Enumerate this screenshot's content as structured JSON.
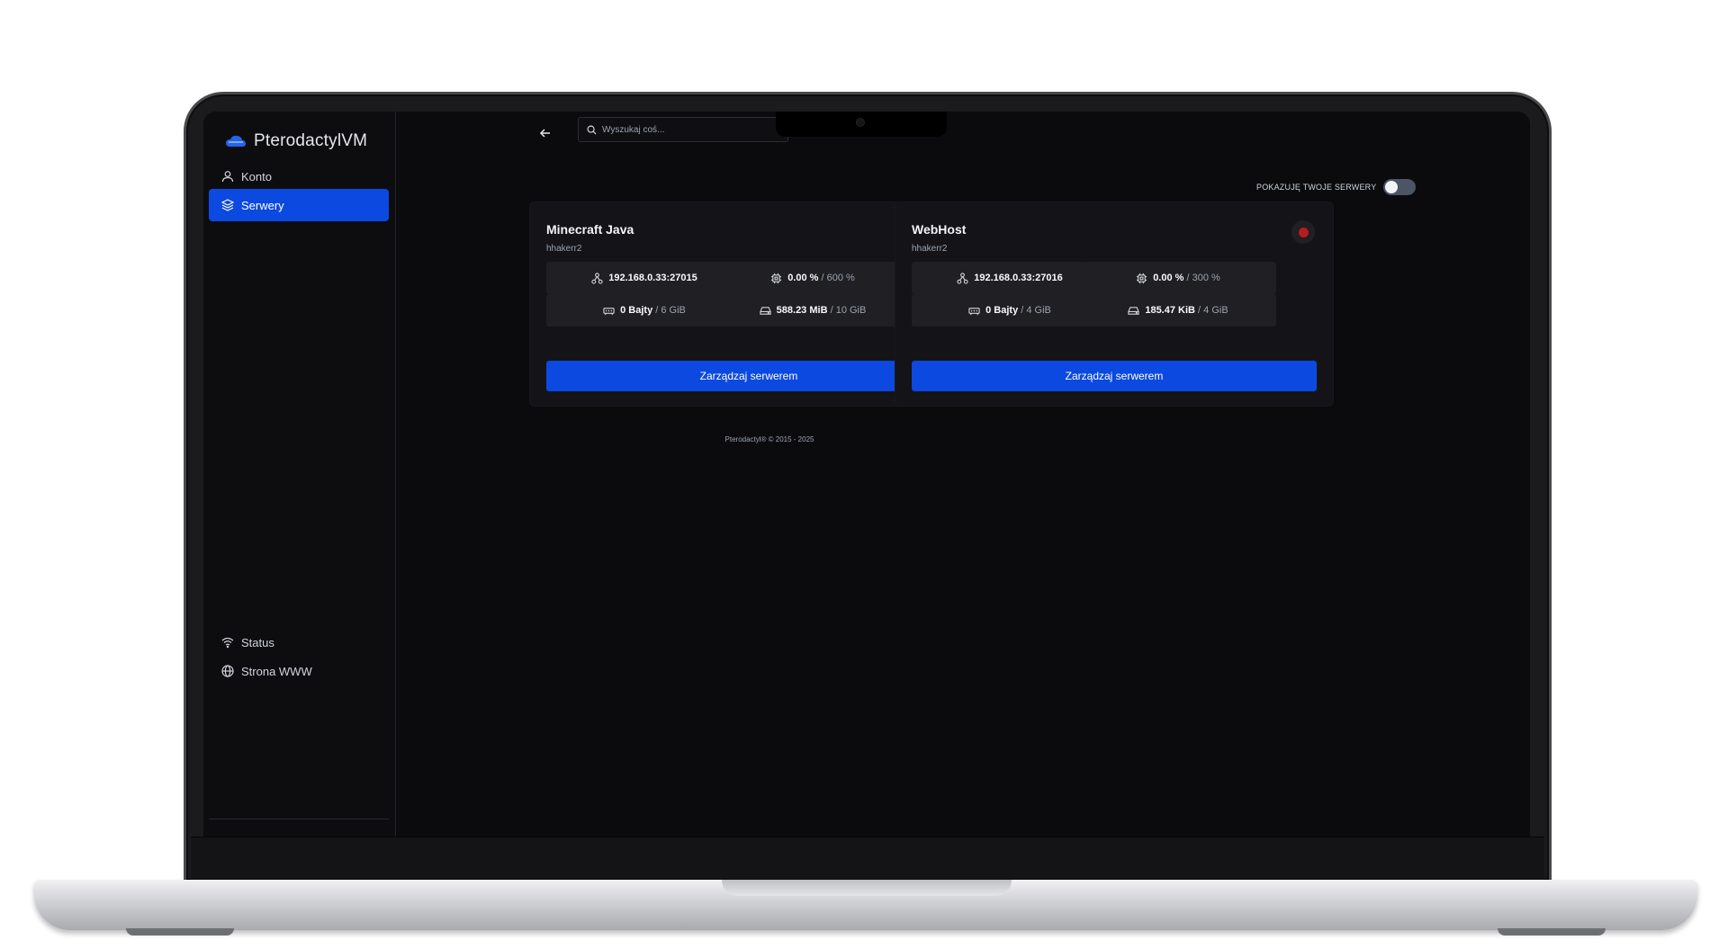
{
  "app": {
    "brand_name": "PterodactylVM",
    "accent_color": "#0b49e0"
  },
  "sidebar": {
    "items": [
      {
        "label": "Konto",
        "icon": "user-icon",
        "active": false
      },
      {
        "label": "Serwery",
        "icon": "layers-icon",
        "active": true
      }
    ],
    "bottom_items": [
      {
        "label": "Status",
        "icon": "wifi-icon"
      },
      {
        "label": "Strona WWW",
        "icon": "globe-icon"
      }
    ]
  },
  "topbar": {
    "search_placeholder": "Wyszukaj coś..."
  },
  "toggle": {
    "label": "POKAZUJĘ TWOJE SERWERY",
    "on": false
  },
  "servers": [
    {
      "name": "Minecraft Java",
      "owner": "hhakerr2",
      "status_color": "#b91c1c",
      "address": "192.168.0.33:27015",
      "cpu_value": "0.00 %",
      "cpu_limit": " / 600 %",
      "memory_value": "0 Bajty",
      "memory_limit": " / 6 GiB",
      "disk_value": "588.23 MiB",
      "disk_limit": " / 10 GiB",
      "manage_label": "Zarządzaj serwerem"
    },
    {
      "name": "WebHost",
      "owner": "hhakerr2",
      "status_color": "#b91c1c",
      "address": "192.168.0.33:27016",
      "cpu_value": "0.00 %",
      "cpu_limit": " / 300 %",
      "memory_value": "0 Bajty",
      "memory_limit": " / 4 GiB",
      "disk_value": "185.47 KiB",
      "disk_limit": " / 4 GiB",
      "manage_label": "Zarządzaj serwerem"
    }
  ],
  "footer": {
    "text": "Pterodactyl® © 2015 - 2025"
  }
}
